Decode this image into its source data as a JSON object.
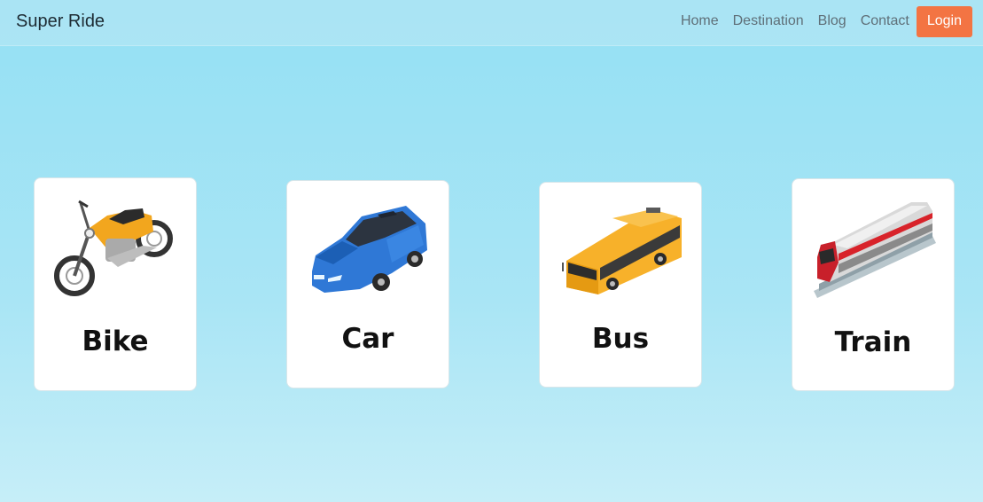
{
  "navbar": {
    "brand": "Super Ride",
    "links": [
      "Home",
      "Destination",
      "Blog",
      "Contact"
    ],
    "login_label": "Login"
  },
  "vehicles": [
    {
      "label": "Bike",
      "icon": "motorcycle-icon"
    },
    {
      "label": "Car",
      "icon": "car-icon"
    },
    {
      "label": "Bus",
      "icon": "bus-icon"
    },
    {
      "label": "Train",
      "icon": "train-icon"
    }
  ],
  "colors": {
    "login_button": "#f37443",
    "background": "#94e0f4"
  }
}
